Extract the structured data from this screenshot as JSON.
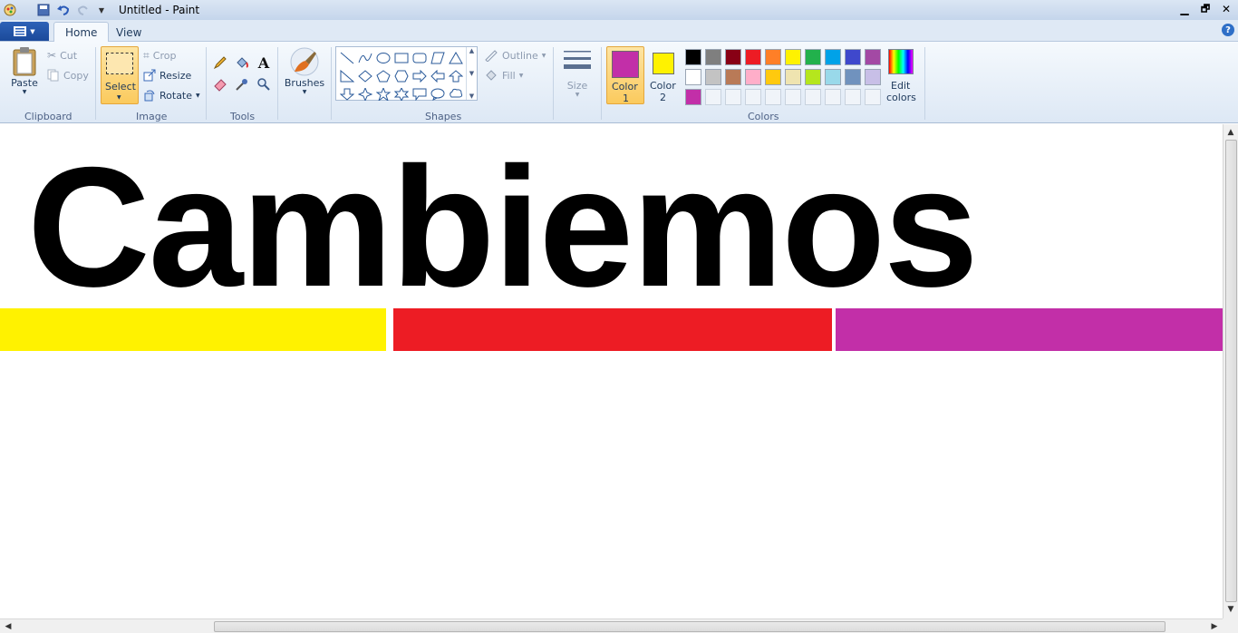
{
  "window": {
    "title": "Untitled - Paint",
    "controls": {
      "minimize": "▁",
      "maximize": "🗗",
      "close": "✕"
    }
  },
  "tabs": [
    {
      "label": "Home",
      "active": true
    },
    {
      "label": "View",
      "active": false
    }
  ],
  "ribbon": {
    "clipboard": {
      "group": "Clipboard",
      "paste": "Paste",
      "cut": "Cut",
      "copy": "Copy"
    },
    "image": {
      "group": "Image",
      "select": "Select",
      "crop": "Crop",
      "resize": "Resize",
      "rotate": "Rotate"
    },
    "tools": {
      "group": "Tools"
    },
    "brushes": {
      "label": "Brushes"
    },
    "shapes": {
      "group": "Shapes",
      "outline": "Outline",
      "fill": "Fill"
    },
    "size": {
      "label": "Size"
    },
    "colors": {
      "group": "Colors",
      "color1_label": "Color",
      "color1_num": "1",
      "color2_label": "Color",
      "color2_num": "2",
      "edit_label": "Edit",
      "edit_label2": "colors",
      "color1": "#c22fa8",
      "color2": "#fff200",
      "palette_row1": [
        "#000000",
        "#7f7f7f",
        "#880015",
        "#ed1c24",
        "#ff7f27",
        "#fff200",
        "#22b14c",
        "#00a2e8",
        "#3f48cc",
        "#a349a4"
      ],
      "palette_row2": [
        "#ffffff",
        "#c3c3c3",
        "#b97a57",
        "#ffaec9",
        "#ffc90e",
        "#efe4b0",
        "#b5e61d",
        "#99d9ea",
        "#7092be",
        "#c8bfe7"
      ],
      "palette_row3": [
        "#c22fa8",
        "",
        "",
        "",
        "",
        "",
        "",
        "",
        "",
        ""
      ]
    }
  },
  "canvas": {
    "text": "Cambiemos",
    "bars": [
      {
        "color": "#fff200"
      },
      {
        "color": "#ed1c24"
      },
      {
        "color": "#c22fa8"
      }
    ]
  }
}
